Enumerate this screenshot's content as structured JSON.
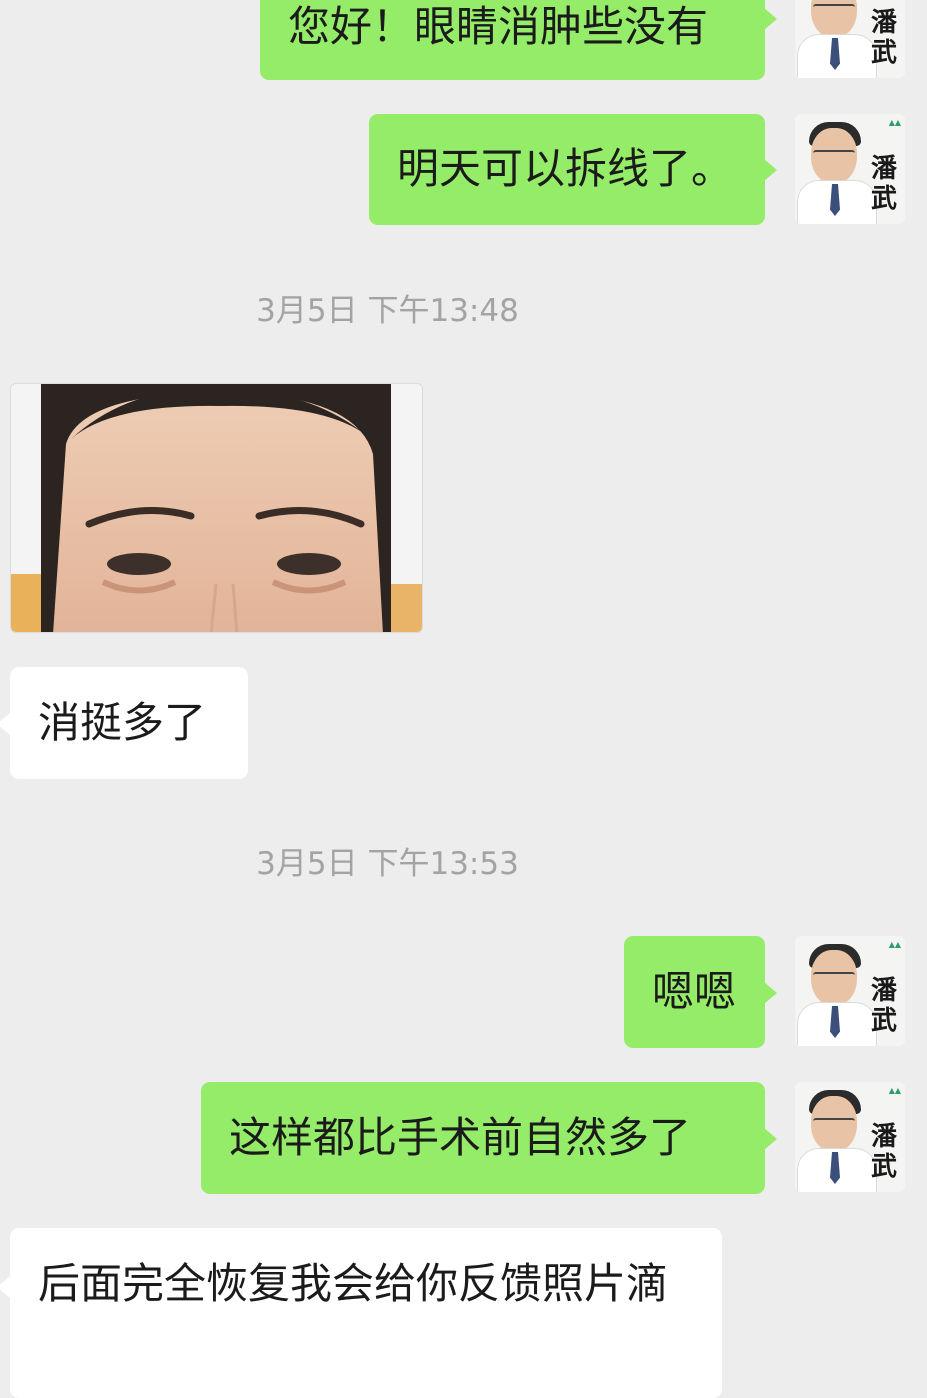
{
  "conversation": {
    "messages": [
      {
        "id": "m1",
        "from": "doctor",
        "text": "您好！眼睛消肿些没有"
      },
      {
        "id": "m2",
        "from": "doctor",
        "text": "明天可以拆线了。"
      },
      {
        "id": "t1",
        "type": "timestamp",
        "text": "3月5日 下午13:48"
      },
      {
        "id": "p1",
        "from": "patient",
        "type": "image"
      },
      {
        "id": "m3",
        "from": "patient",
        "text": "消挺多了"
      },
      {
        "id": "t2",
        "type": "timestamp",
        "text": "3月5日 下午13:53"
      },
      {
        "id": "m4",
        "from": "doctor",
        "text": "嗯嗯"
      },
      {
        "id": "m5",
        "from": "doctor",
        "text": "这样都比手术前自然多了"
      },
      {
        "id": "m6",
        "from": "patient",
        "text": "后面完全恢复我会给你反馈照片滴"
      }
    ]
  },
  "doctor_avatar": {
    "seal_text": "潘武"
  },
  "colors": {
    "background": "#ededed",
    "sent_bubble": "#95ec69",
    "received_bubble": "#ffffff",
    "timestamp_text": "#a3a3a3"
  },
  "icons": {
    "avatar": "doctor-avatar-icon",
    "photo": "patient-photo"
  }
}
